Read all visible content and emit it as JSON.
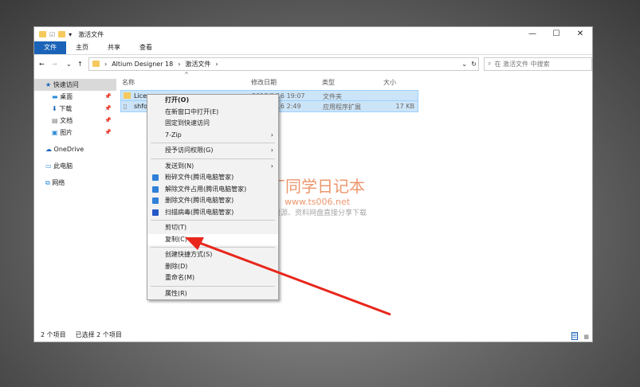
{
  "window": {
    "title": "激活文件",
    "controls": [
      "—",
      "☐",
      "✕"
    ]
  },
  "ribbon": {
    "tabs": [
      "文件",
      "主页",
      "共享",
      "查看"
    ]
  },
  "address": {
    "path": [
      "Altium Designer 18",
      "激活文件"
    ],
    "search_placeholder": "在 激活文件 中搜索"
  },
  "sidebar": {
    "items": [
      {
        "label": "快速访问",
        "icon": "star-icon"
      },
      {
        "label": "桌面",
        "icon": "desktop-icon"
      },
      {
        "label": "下载",
        "icon": "download-icon"
      },
      {
        "label": "文档",
        "icon": "document-icon"
      },
      {
        "label": "图片",
        "icon": "picture-icon"
      },
      {
        "label": "OneDrive",
        "icon": "cloud-icon"
      },
      {
        "label": "此电脑",
        "icon": "computer-icon"
      },
      {
        "label": "网络",
        "icon": "network-icon"
      }
    ]
  },
  "columns": [
    "名称",
    "修改日期",
    "类型",
    "大小"
  ],
  "files": [
    {
      "name": "Licenses",
      "date": "2018/9/16 19:07",
      "type": "文件夹",
      "size": ""
    },
    {
      "name": "shfolder.dll",
      "date": "2018/9/16 2:49",
      "type": "应用程序扩展",
      "size": "17 KB"
    }
  ],
  "status": {
    "count": "2 个项目",
    "selected": "已选择 2 个项目"
  },
  "context_menu": [
    [
      "打开(O)",
      "在新窗口中打开(E)",
      "固定到快速访问",
      "7-Zip"
    ],
    [
      "授予访问权限(G)"
    ],
    [
      "发送到(N)",
      "粉碎文件(腾讯电脑管家)",
      "解除文件占用(腾讯电脑管家)",
      "删除文件(腾讯电脑管家)",
      "扫描病毒(腾讯电脑管家)"
    ],
    [
      "剪切(T)",
      "复制(C)"
    ],
    [
      "创建快捷方式(S)",
      "删除(D)",
      "重命名(M)"
    ],
    [
      "属性(R)"
    ]
  ],
  "watermark": {
    "title": "丁同学日记本",
    "url": "www.ts006.net",
    "slogan": "软件、资源、资料网盘直接分享下载"
  }
}
